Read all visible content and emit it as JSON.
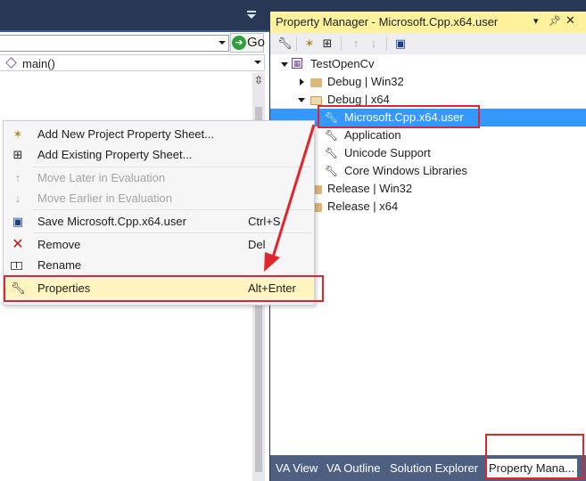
{
  "editor": {
    "go_label": "Go",
    "function_combo_value": "main()"
  },
  "property_manager": {
    "title": "Property Manager - Microsoft.Cpp.x64.user",
    "title_icons": [
      "dropdown-icon",
      "pin-icon",
      "close-icon"
    ],
    "toolbar": [
      "wrench-icon",
      "new-sheet-icon",
      "add-sheet-icon",
      "move-up-icon",
      "move-down-icon",
      "save-icon"
    ],
    "tree": [
      {
        "label": "TestOpenCv",
        "icon": "project-icon",
        "level": 0,
        "expander": "open"
      },
      {
        "label": "Debug | Win32",
        "icon": "folder-icon",
        "level": 1,
        "expander": "closed"
      },
      {
        "label": "Debug | x64",
        "icon": "folder-icon",
        "level": 1,
        "expander": "open"
      },
      {
        "label": "Microsoft.Cpp.x64.user",
        "icon": "wrench-icon",
        "level": 2,
        "selected": true
      },
      {
        "label": "Application",
        "icon": "wrench-icon",
        "level": 2
      },
      {
        "label": "Unicode Support",
        "icon": "wrench-icon",
        "level": 2
      },
      {
        "label": "Core Windows Libraries",
        "icon": "wrench-icon",
        "level": 2
      },
      {
        "label": "Release | Win32",
        "icon": "folder-icon",
        "level": 1,
        "expander": "closed"
      },
      {
        "label": "Release | x64",
        "icon": "folder-icon",
        "level": 1,
        "expander": "closed"
      }
    ],
    "bottom_tabs": [
      "VA View",
      "VA Outline",
      "Solution Explorer",
      "Property Mana..."
    ]
  },
  "context_menu": {
    "items": [
      {
        "label": "Add New Project Property Sheet...",
        "shortcut": "",
        "icon": "new-sheet-icon",
        "enabled": true
      },
      {
        "label": "Add Existing Property Sheet...",
        "shortcut": "",
        "icon": "add-sheet-icon",
        "enabled": true
      },
      {
        "label": "Move Later in Evaluation",
        "shortcut": "",
        "icon": "move-down-icon",
        "enabled": false
      },
      {
        "label": "Move Earlier in Evaluation",
        "shortcut": "",
        "icon": "move-up-icon",
        "enabled": false
      },
      {
        "label": "Save Microsoft.Cpp.x64.user",
        "shortcut": "Ctrl+S",
        "icon": "save-icon",
        "enabled": true
      },
      {
        "label": "Remove",
        "shortcut": "Del",
        "icon": "remove-icon",
        "enabled": true
      },
      {
        "label": "Rename",
        "shortcut": "",
        "icon": "rename-icon",
        "enabled": true
      },
      {
        "label": "Properties",
        "shortcut": "Alt+Enter",
        "icon": "wrench-icon",
        "enabled": true
      }
    ]
  },
  "colors": {
    "title_active": "#fff29d",
    "selection": "#3399ff",
    "menu_highlight": "#fdf4bf",
    "annotation": "#e2252c",
    "ide_frame": "#293955"
  }
}
